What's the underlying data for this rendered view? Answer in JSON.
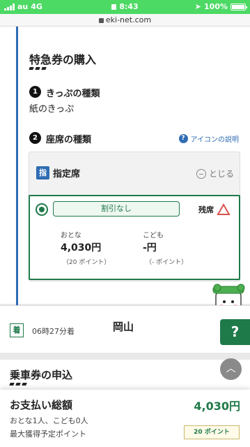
{
  "status_bar": {
    "carrier": "au",
    "network": "4G",
    "time": "8:43",
    "battery": "100%"
  },
  "url_bar": {
    "domain": "eki-net.com"
  },
  "express_ticket": {
    "title": "特急券の購入",
    "step1": {
      "num": "1",
      "label": "きっぷの種類",
      "value": "紙のきっぷ"
    },
    "step2": {
      "num": "2",
      "label": "座席の種類"
    },
    "help_link": "アイコンの説明",
    "help_icon": "?",
    "seat": {
      "badge": "指",
      "label": "指定席",
      "close_label": "とじる",
      "option": {
        "discount": "割引なし",
        "remaining_label": "残席",
        "adult_label": "おとな",
        "adult_price": "4,030円",
        "adult_points": "（20 ポイント）",
        "child_label": "こども",
        "child_price": "-円",
        "child_points": "（- ポイント）"
      }
    }
  },
  "arrival": {
    "badge": "着",
    "time": "06時27分着",
    "station": "岡山"
  },
  "help_fab": "?",
  "scroll_top_icon": "︿",
  "ticket": {
    "title": "乗車券の申込"
  },
  "summary": {
    "title": "お支払い総額",
    "people": "おとな1人、こども0人",
    "points_label": "最大獲得予定ポイント",
    "total": "4,030円",
    "points_badge": "20 ポイント"
  },
  "colors": {
    "status_green": "#4cd964",
    "brand_green": "#1f7a4a",
    "accent_blue": "#2f6cb3",
    "warning_red": "#d9534f"
  }
}
